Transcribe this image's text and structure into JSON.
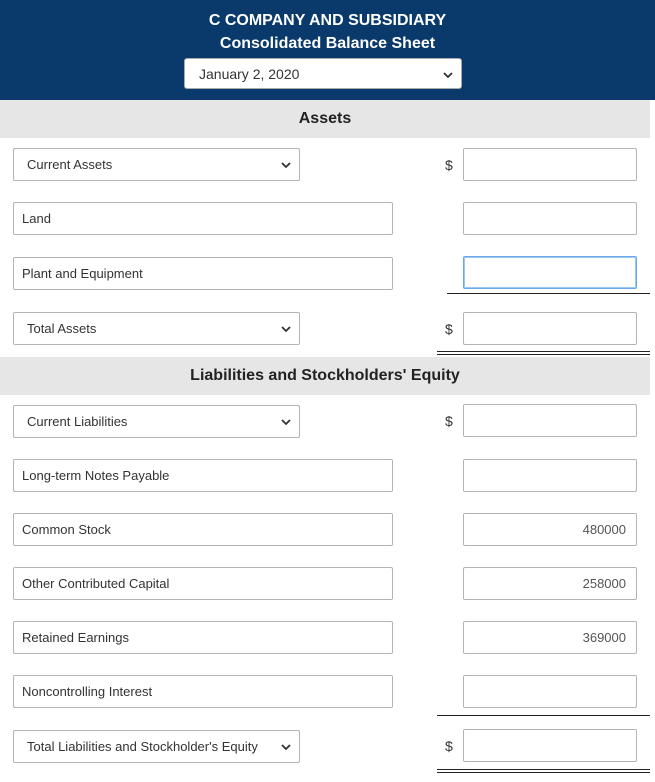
{
  "header": {
    "company": "C COMPANY AND SUBSIDIARY",
    "statement": "Consolidated Balance Sheet",
    "date_value": "January 2, 2020"
  },
  "assets": {
    "section_title": "Assets",
    "rows": [
      {
        "label": "Current Assets",
        "amount": ""
      },
      {
        "label": "Land",
        "amount": ""
      },
      {
        "label": "Plant and Equipment",
        "amount": ""
      }
    ],
    "total": {
      "label": "Total Assets",
      "amount": ""
    }
  },
  "liabilities": {
    "section_title": "Liabilities and Stockholders' Equity",
    "rows": [
      {
        "label": "Current Liabilities",
        "amount": ""
      },
      {
        "label": "Long-term Notes Payable",
        "amount": ""
      },
      {
        "label": "Common Stock",
        "amount": "480000"
      },
      {
        "label": "Other Contributed Capital",
        "amount": "258000"
      },
      {
        "label": "Retained Earnings",
        "amount": "369000"
      },
      {
        "label": "Noncontrolling Interest",
        "amount": ""
      }
    ],
    "total": {
      "label": "Total Liabilities and Stockholder's Equity",
      "amount": ""
    }
  },
  "currency_symbol": "$",
  "icons": {
    "dropdown": "chevron-down-icon"
  }
}
